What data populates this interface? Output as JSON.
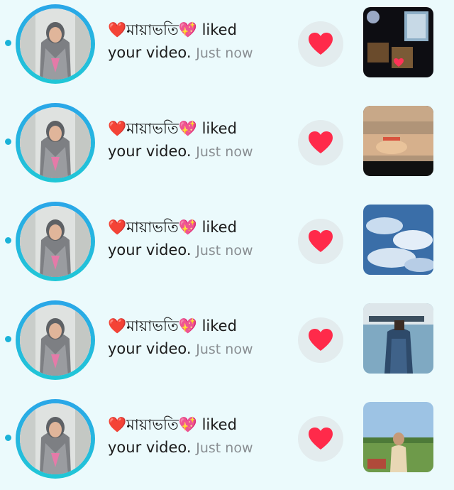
{
  "notifications": [
    {
      "username": "❤️মায়াভতি💖",
      "action_1": " liked",
      "action_2": "your video.",
      "time": "Just now",
      "thumb": "night-room"
    },
    {
      "username": "❤️মায়াভতি💖",
      "action_1": " liked",
      "action_2": "your video.",
      "time": "Just now",
      "thumb": "sunset-shore"
    },
    {
      "username": "❤️মায়াভতি💖",
      "action_1": " liked",
      "action_2": "your video.",
      "time": "Just now",
      "thumb": "blue-sky"
    },
    {
      "username": "❤️মায়াভতি💖",
      "action_1": " liked",
      "action_2": "your video.",
      "time": "Just now",
      "thumb": "person-denim"
    },
    {
      "username": "❤️মায়াভতি💖",
      "action_1": " liked",
      "action_2": "your video.",
      "time": "Just now",
      "thumb": "field-boy"
    }
  ],
  "colors": {
    "background": "#ebfafc",
    "heart": "#ff2a4a",
    "ring_start": "#2aa6e8",
    "ring_end": "#20c7d6",
    "unread_dot": "#1ab2d8",
    "time_gray": "#8a8f93"
  },
  "icons": {
    "like": "heart-icon",
    "unread": "unread-dot-icon"
  }
}
